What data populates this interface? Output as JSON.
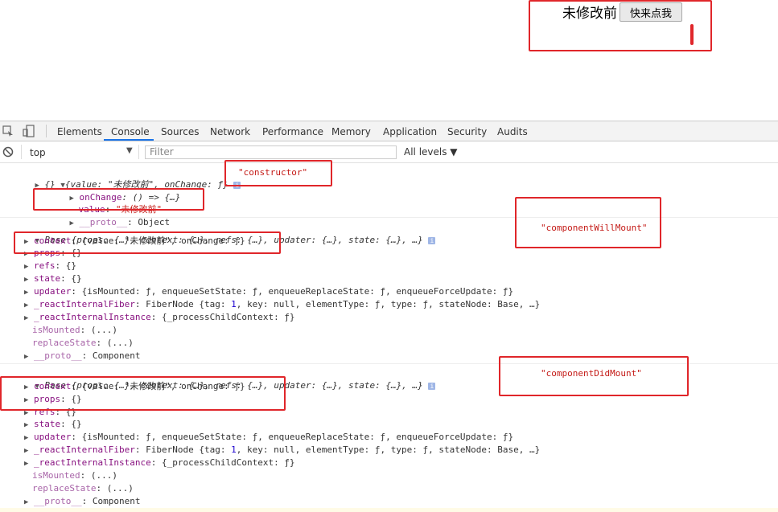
{
  "page": {
    "text": "未修改前",
    "button_label": "快来点我"
  },
  "devtools": {
    "tabs": [
      "Elements",
      "Console",
      "Sources",
      "Network",
      "Performance",
      "Memory",
      "Application",
      "Security",
      "Audits"
    ],
    "active_tab": "Console",
    "context": "top",
    "filter_placeholder": "Filter",
    "levels": "All levels ▼"
  },
  "console": {
    "log1": {
      "summary_prefix": "{} ",
      "summary": "{value: \"未修改前\", onChange: ƒ}",
      "onchange_key": "onChange",
      "onchange_val": ": () => {…}",
      "value_key": "value",
      "value_val": "\"未修改前\"",
      "proto_key": "__proto__",
      "proto_val": ": Object",
      "label": "\"constructor\""
    },
    "log2": {
      "summary": "Base {props: {…}, context: {…}, refs: {…}, updater: {…}, state: {…}, …}",
      "label": "\"componentWillMount\"",
      "context_key": "context",
      "context_val": ": {value: \"未修改前\", onChange: ƒ}",
      "props_key": "props",
      "props_val": ": {}",
      "refs_key": "refs",
      "refs_val": ": {}",
      "state_key": "state",
      "state_val": ": {}",
      "updater_key": "updater",
      "updater_val": ": {isMounted: ƒ, enqueueSetState: ƒ, enqueueReplaceState: ƒ, enqueueForceUpdate: ƒ}",
      "fiber_key": "_reactInternalFiber",
      "fiber_val_a": ": FiberNode {tag: ",
      "fiber_num": "1",
      "fiber_val_b": ", key: null, elementType: ƒ, type: ƒ, stateNode: Base, …}",
      "instance_key": "_reactInternalInstance",
      "instance_val": ": {_processChildContext: ƒ}",
      "ismounted_key": "isMounted",
      "ismounted_val": ": (...)",
      "replacestate_key": "replaceState",
      "replacestate_val": ": (...)",
      "proto_key": "__proto__",
      "proto_val": ": Component"
    },
    "log3": {
      "summary": "Base {props: {…}, context: {…}, refs: {…}, updater: {…}, state: {…}, …}",
      "label": "\"componentDidMount\"",
      "context_key": "context",
      "context_val": ": {value: \"未修改前\", onChange: ƒ}",
      "props_key": "props",
      "props_val": ": {}",
      "refs_key": "refs",
      "refs_val": ": {}",
      "state_key": "state",
      "state_val": ": {}",
      "updater_key": "updater",
      "updater_val": ": {isMounted: ƒ, enqueueSetState: ƒ, enqueueReplaceState: ƒ, enqueueForceUpdate: ƒ}",
      "fiber_key": "_reactInternalFiber",
      "fiber_val_a": ": FiberNode {tag: ",
      "fiber_num": "1",
      "fiber_val_b": ", key: null, elementType: ƒ, type: ƒ, stateNode: Base, …}",
      "instance_key": "_reactInternalInstance",
      "instance_val": ": {_processChildContext: ƒ}",
      "ismounted_key": "isMounted",
      "ismounted_val": ": (...)",
      "replacestate_key": "replaceState",
      "replacestate_val": ": (...)",
      "proto_key": "__proto__",
      "proto_val": ": Component"
    }
  },
  "colors": {
    "annotation": "#e0262a",
    "key": "#881280",
    "string": "#c41a16",
    "active_tab": "#1a73e8"
  },
  "icons": [
    "inspect-icon",
    "device-toggle-icon",
    "clear-console-icon",
    "dropdown-arrow-icon",
    "info-icon",
    "expand-triangle-icon",
    "collapse-triangle-icon"
  ]
}
